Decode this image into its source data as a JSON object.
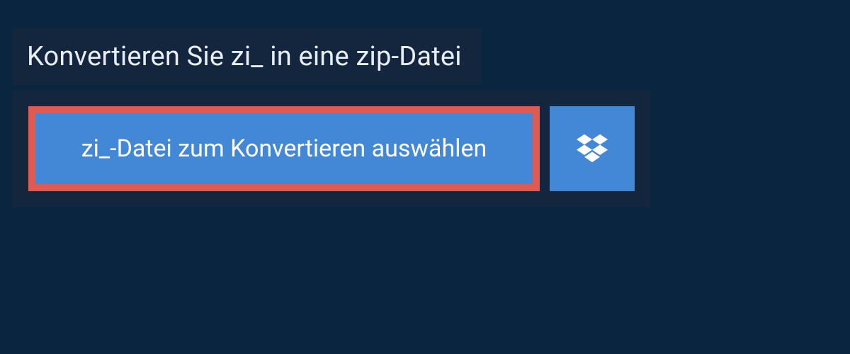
{
  "header": {
    "title": "Konvertieren Sie zi_ in eine zip-Datei"
  },
  "upload": {
    "select_label": "zi_-Datei zum Konvertieren auswählen",
    "dropbox_icon": "dropbox-icon"
  },
  "colors": {
    "background": "#0a2540",
    "panel": "#14263d",
    "button": "#4388d6",
    "highlight_border": "#e05a52",
    "text": "#e8eef5"
  }
}
